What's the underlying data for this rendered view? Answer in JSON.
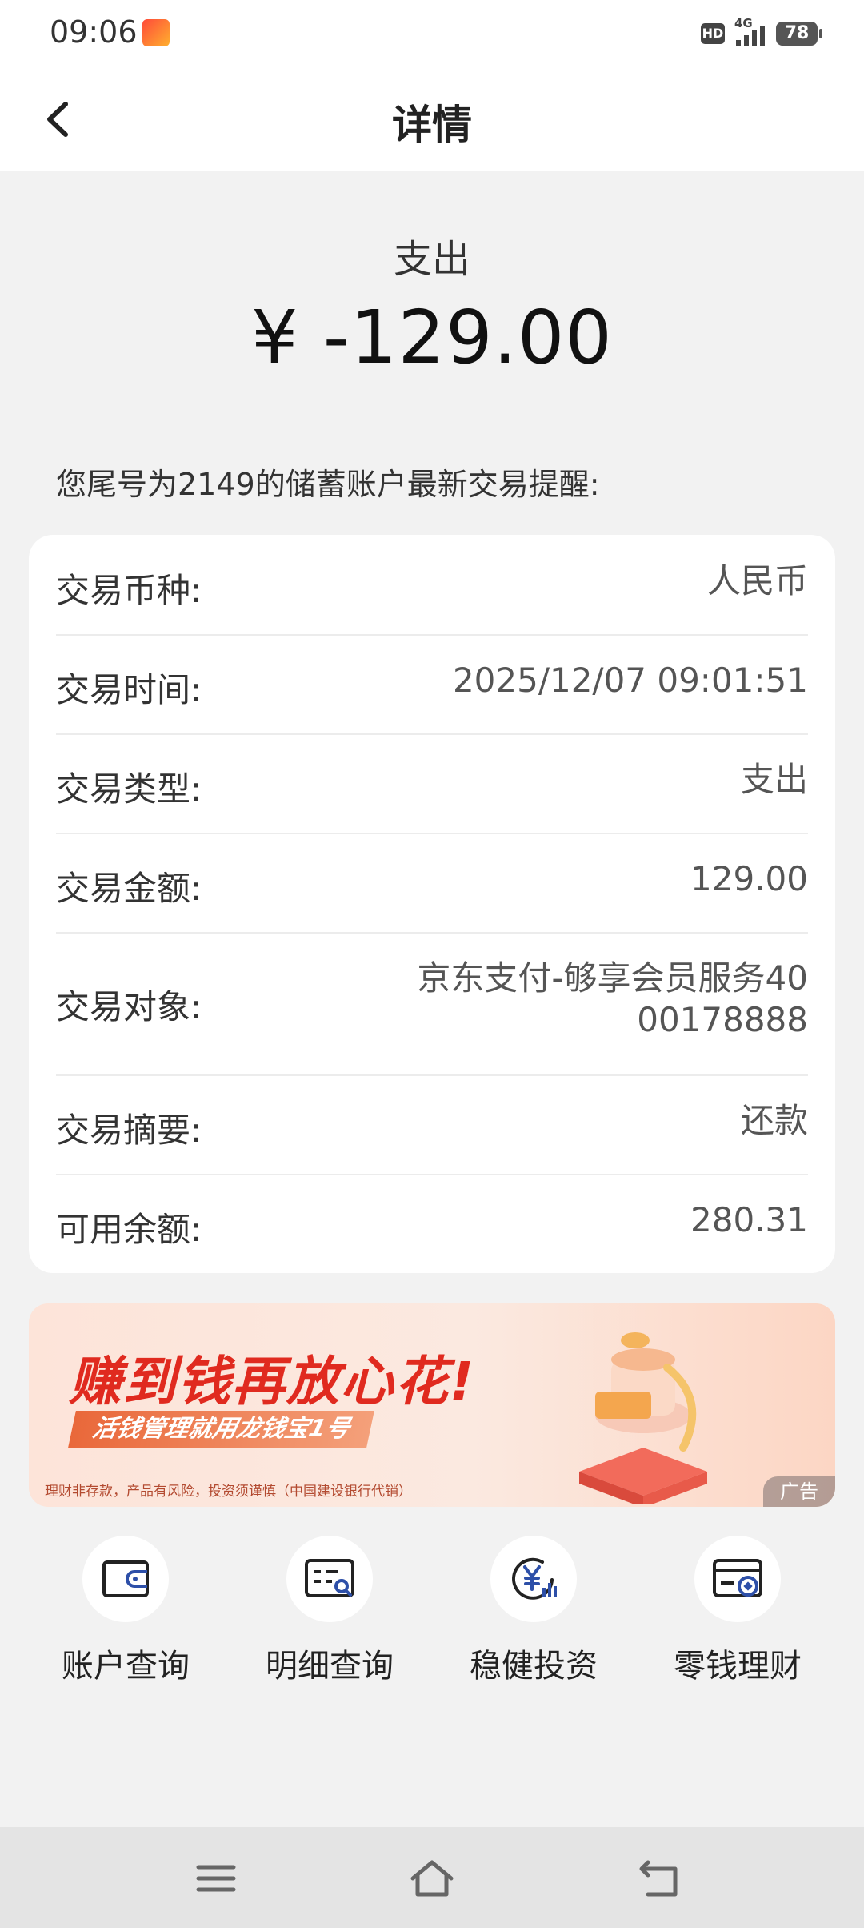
{
  "status": {
    "time": "09:06",
    "hd": "HD",
    "network": "4G",
    "battery": "78"
  },
  "nav": {
    "title": "详情"
  },
  "summary": {
    "type": "支出",
    "amount": "¥ -129.00"
  },
  "notice": "您尾号为2149的储蓄账户最新交易提醒:",
  "details": [
    {
      "label": "交易币种:",
      "value": "人民币"
    },
    {
      "label": "交易时间:",
      "value": "2025/12/07 09:01:51"
    },
    {
      "label": "交易类型:",
      "value": "支出"
    },
    {
      "label": "交易金额:",
      "value": "129.00"
    },
    {
      "label": "交易对象:",
      "value_line1": "京东支付-够享会员服务40",
      "value_line2": "00178888"
    },
    {
      "label": "交易摘要:",
      "value": "还款"
    },
    {
      "label": "可用余额:",
      "value": "280.31"
    }
  ],
  "banner": {
    "headline": "赚到钱再放心花!",
    "subline": "活钱管理就用龙钱宝1号",
    "disclaimer": "理财非存款，产品有风险，投资须谨慎（中国建设银行代销）",
    "ad_label": "广告"
  },
  "shortcuts": [
    {
      "label": "账户查询",
      "icon": "wallet-icon"
    },
    {
      "label": "明细查询",
      "icon": "statement-search-icon"
    },
    {
      "label": "稳健投资",
      "icon": "yuan-chart-icon"
    },
    {
      "label": "零钱理财",
      "icon": "card-coin-icon"
    }
  ],
  "colors": {
    "accent_red": "#e02a1f",
    "icon_blue": "#2d4fa8"
  }
}
